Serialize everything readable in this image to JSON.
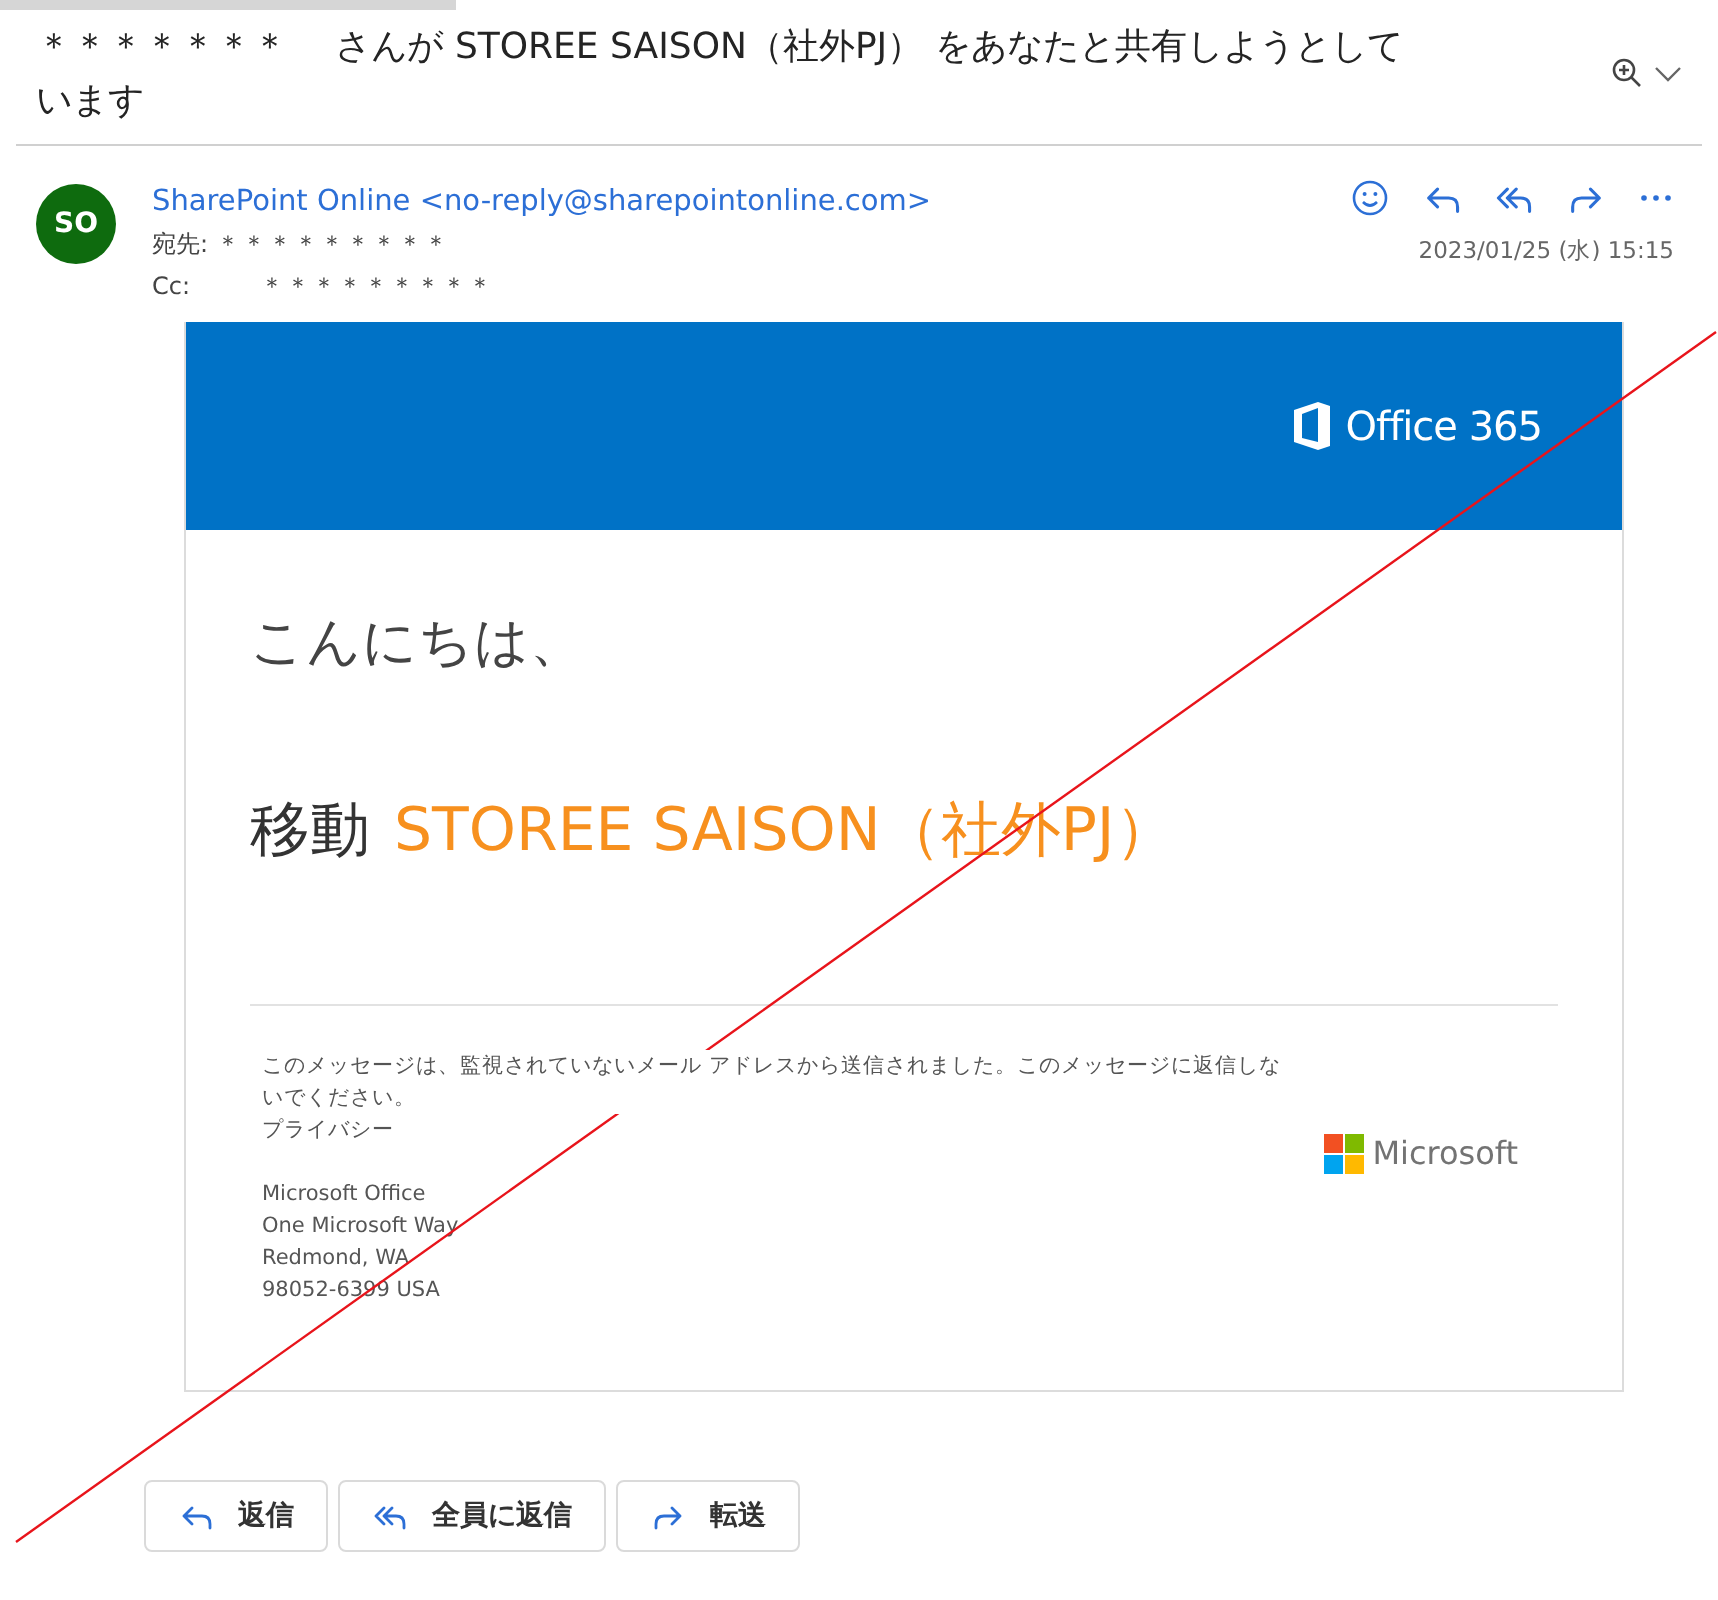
{
  "subject": "＊＊＊＊＊＊＊　 さんが STOREE SAISON（社外PJ） をあなたと共有しようとしています",
  "sender": {
    "initials": "SO",
    "name": "SharePoint Online <no-reply@sharepointonline.com>",
    "to_label": "宛先:",
    "to": "＊＊＊＊＊＊＊＊＊",
    "cc_label": "Cc:",
    "cc": "＊＊＊＊＊＊＊＊＊",
    "date": "2023/01/25 (水) 15:15"
  },
  "message": {
    "brand": "Office 365",
    "greeting": "こんにちは、",
    "action": "移動",
    "item": "STOREE SAISON（社外PJ）",
    "notice": "このメッセージは、監視されていないメール アドレスから送信されました。このメッセージに返信しないでください。",
    "privacy": "プライバシー",
    "address": [
      "Microsoft Office",
      "One Microsoft Way",
      "Redmond, WA",
      "98052-6399 USA"
    ],
    "footer_brand": "Microsoft"
  },
  "buttons": [
    {
      "kind": "reply",
      "label": "返信"
    },
    {
      "kind": "reply-all",
      "label": "全員に返信"
    },
    {
      "kind": "forward",
      "label": "転送"
    }
  ]
}
